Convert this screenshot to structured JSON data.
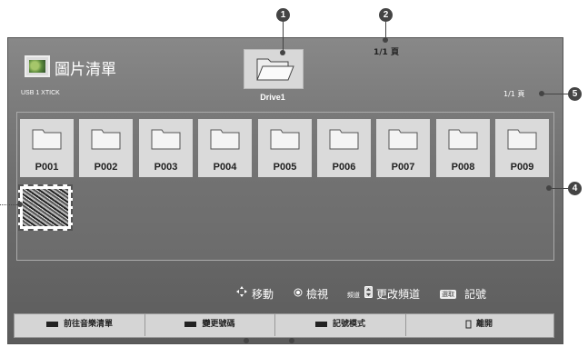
{
  "header": {
    "title": "圖片清單",
    "device": "USB 1 XTICK",
    "page_top": "1/1 頁",
    "page_right": "1/1 頁",
    "drive_label": "Drive1"
  },
  "folders": [
    "P001",
    "P002",
    "P003",
    "P004",
    "P005",
    "P006",
    "P007",
    "P008",
    "P009"
  ],
  "hints": {
    "move": "移動",
    "view": "檢視",
    "channel_prefix": "頻道",
    "change_channel": "更改頻道",
    "mark_prefix": "選取",
    "mark": "記號"
  },
  "buttons": [
    "前往音樂清單",
    "變更號碼",
    "記號模式",
    "離開"
  ],
  "callouts": [
    "1",
    "2",
    "4",
    "5"
  ],
  "colors": {
    "screen": "#6f6f6f",
    "tile": "#dadada",
    "callout": "#444444"
  }
}
